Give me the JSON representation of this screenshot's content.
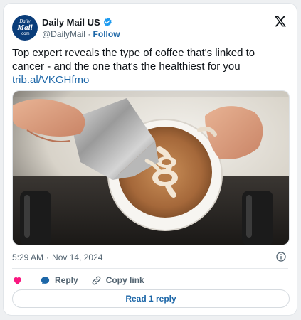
{
  "account": {
    "avatar_text_1": "Daily",
    "avatar_text_2": "Mail",
    "avatar_text_3": ".com",
    "display_name": "Daily Mail US",
    "handle": "@DailyMail",
    "separator": "·",
    "follow_label": "Follow",
    "verified_color": "#1d9bf0"
  },
  "tweet": {
    "text": "Top expert reveals the type of coffee that's linked to cancer - and the one that's the healthiest for you",
    "link": "trib.al/VKGHfmo"
  },
  "media": {
    "alt": "latte art being poured into a cup"
  },
  "meta": {
    "time": "5:29 AM",
    "separator": "·",
    "date": "Nov 14, 2024"
  },
  "actions": {
    "like_color": "#f91880",
    "reply_label": "Reply",
    "copy_link_label": "Copy link"
  },
  "footer": {
    "read_replies_label": "Read 1 reply"
  },
  "colors": {
    "accent": "#1d67a8",
    "text": "#0f1419",
    "muted": "#536471"
  }
}
